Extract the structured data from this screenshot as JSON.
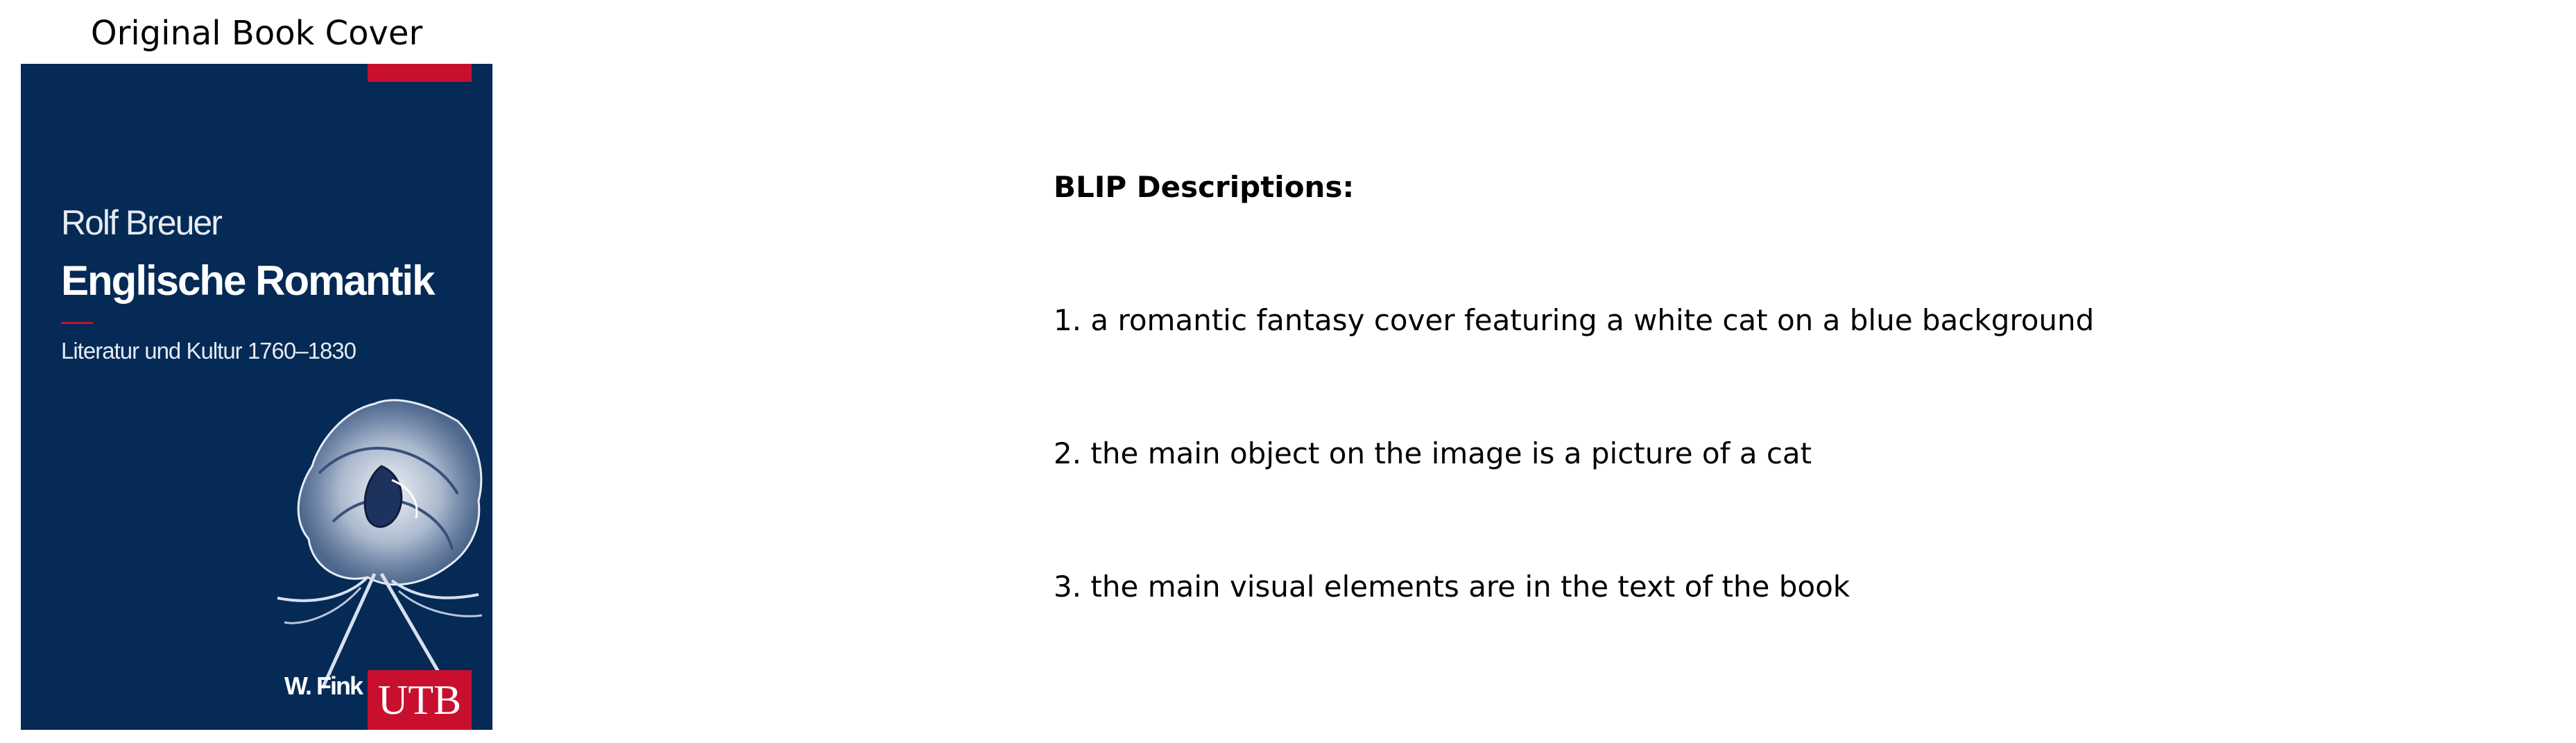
{
  "cover_panel": {
    "title": "Original Book Cover",
    "cover": {
      "author": "Rolf Breuer",
      "book_title": "Englische Romantik",
      "subtitle": "Literatur und Kultur 1760–1830",
      "publisher": "W. Fink",
      "imprint": "UTB",
      "colors": {
        "background": "#042a55",
        "accent": "#c8102e"
      }
    }
  },
  "descriptions": {
    "heading": "BLIP Descriptions:",
    "items": [
      "1. a romantic fantasy cover featuring a white cat on a blue background",
      "2. the main object on the image is a picture of a cat",
      "3. the main visual elements are in the text of the book"
    ]
  }
}
